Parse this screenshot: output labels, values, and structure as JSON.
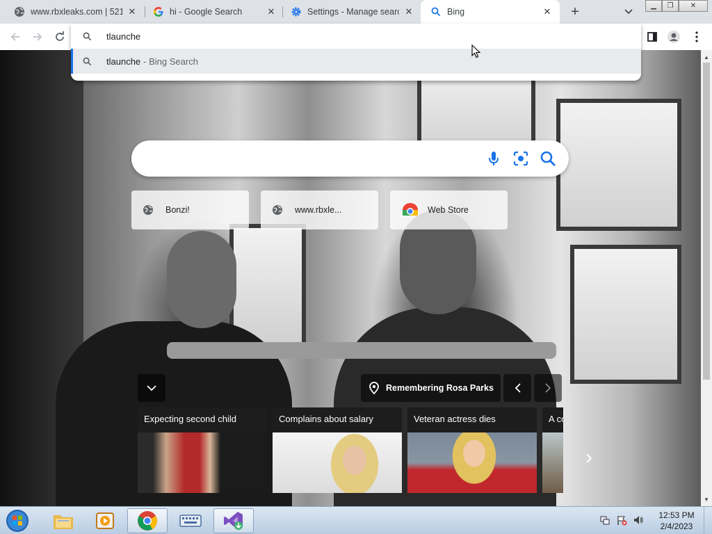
{
  "tabs": [
    {
      "title": "www.rbxleaks.com | 521:",
      "favicon": "globe-icon",
      "active": false
    },
    {
      "title": "hi - Google Search",
      "favicon": "google-g-icon",
      "active": false
    },
    {
      "title": "Settings - Manage search",
      "favicon": "settings-gear-icon",
      "active": false
    },
    {
      "title": "Bing",
      "favicon": "search-icon",
      "active": true
    }
  ],
  "omnibox": {
    "value": "tlaunche",
    "suggestion": {
      "query": "tlaunche",
      "source": "- Bing Search"
    }
  },
  "shortcuts": [
    {
      "label": "Bonzi!",
      "icon": "globe-icon"
    },
    {
      "label": "www.rbxle...",
      "icon": "globe-icon"
    },
    {
      "label": "Web Store",
      "icon": "chrome-web-store-icon"
    }
  ],
  "location": {
    "label": "Remembering Rosa Parks"
  },
  "news_cards": [
    {
      "title": "Expecting second child"
    },
    {
      "title": "Complains about salary"
    },
    {
      "title": "Veteran actress dies"
    },
    {
      "title": "A co"
    }
  ],
  "clock": {
    "time": "12:53 PM",
    "date": "2/4/2023"
  },
  "colors": {
    "accent": "#1a73e8",
    "tabstrip": "#dee1e6",
    "taskbar": "#c5d6ea"
  }
}
